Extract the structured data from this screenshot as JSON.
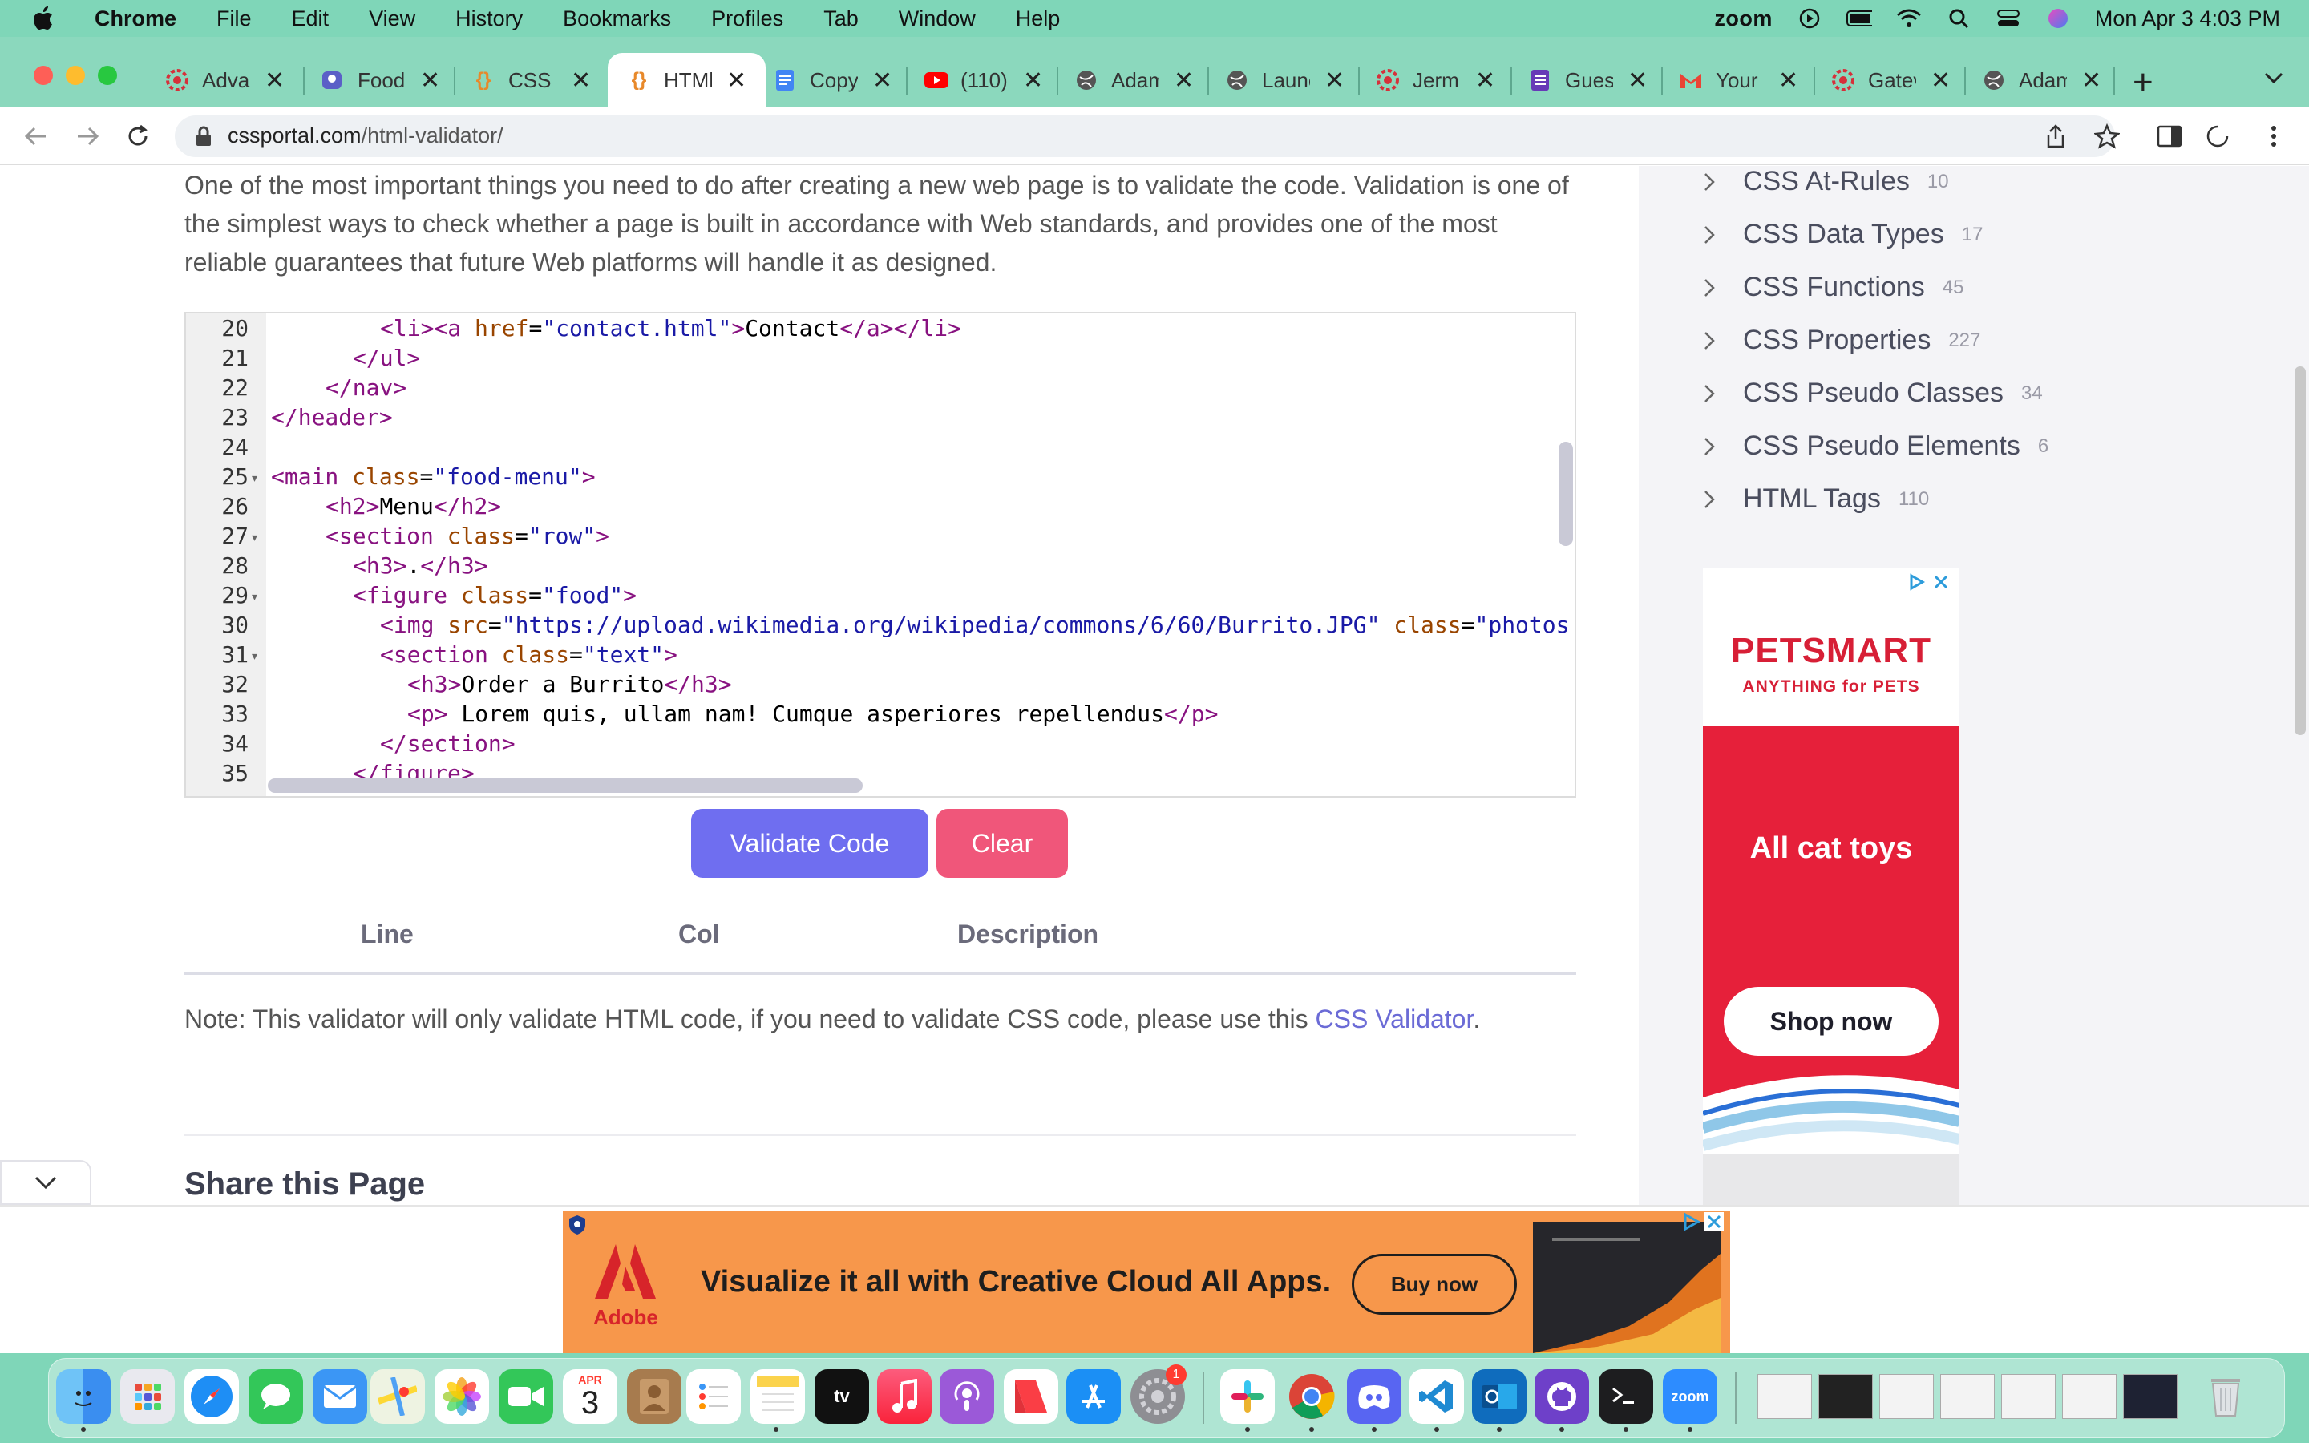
{
  "menubar": {
    "app_name": "Chrome",
    "menus": [
      "File",
      "Edit",
      "View",
      "History",
      "Bookmarks",
      "Profiles",
      "Tab",
      "Window",
      "Help"
    ],
    "zoom_label": "zoom",
    "datetime": "Mon Apr 3  4:03 PM"
  },
  "tabs": [
    {
      "title": "Advar",
      "icon": "gear-red-icon"
    },
    {
      "title": "Food",
      "icon": "teams-icon"
    },
    {
      "title": "CSS V",
      "icon": "braces-icon"
    },
    {
      "title": "HTMl",
      "icon": "braces-icon",
      "active": true
    },
    {
      "title": "Copy",
      "icon": "docs-icon"
    },
    {
      "title": "(110)",
      "icon": "youtube-icon"
    },
    {
      "title": "Adam",
      "icon": "globe-icon"
    },
    {
      "title": "Launc",
      "icon": "globe-icon"
    },
    {
      "title": "Jerm",
      "icon": "gear-red-icon"
    },
    {
      "title": "Gues",
      "icon": "forms-icon"
    },
    {
      "title": "Your",
      "icon": "gmail-icon"
    },
    {
      "title": "Gatev",
      "icon": "gear-red-icon"
    },
    {
      "title": "Adam",
      "icon": "globe-icon"
    }
  ],
  "address": {
    "domain": "cssportal.com",
    "path": "/html-validator/"
  },
  "page": {
    "intro": "One of the most important things you need to do after creating a new web page is to validate the code. Validation is one of the simplest ways to check whether a page is built in accordance with Web standards, and provides one of the most reliable guarantees that future Web platforms will handle it as designed.",
    "editor_lines": [
      {
        "n": "20",
        "fold": false
      },
      {
        "n": "21",
        "fold": false
      },
      {
        "n": "22",
        "fold": false
      },
      {
        "n": "23",
        "fold": false
      },
      {
        "n": "24",
        "fold": false
      },
      {
        "n": "25",
        "fold": true
      },
      {
        "n": "26",
        "fold": false
      },
      {
        "n": "27",
        "fold": true
      },
      {
        "n": "28",
        "fold": false
      },
      {
        "n": "29",
        "fold": true
      },
      {
        "n": "30",
        "fold": false
      },
      {
        "n": "31",
        "fold": true
      },
      {
        "n": "32",
        "fold": false
      },
      {
        "n": "33",
        "fold": false
      },
      {
        "n": "34",
        "fold": false
      },
      {
        "n": "35",
        "fold": false
      }
    ],
    "code": {
      "l20": {
        "t1": "<li><a ",
        "a1": "href",
        "eq": "=",
        "s1": "\"contact.html\"",
        "t2": ">",
        "txt": "Contact",
        "t3": "</a></li>"
      },
      "l21": "</ul>",
      "l22": "</nav>",
      "l23": "</header>",
      "l25": {
        "t1": "<main ",
        "a1": "class",
        "eq": "=",
        "s1": "\"food-menu\"",
        "t2": ">"
      },
      "l26": {
        "t1": "<h2>",
        "txt": "Menu",
        "t2": "</h2>"
      },
      "l27": {
        "t1": "<section ",
        "a1": "class",
        "eq": "=",
        "s1": "\"row\"",
        "t2": ">"
      },
      "l28": {
        "t1": "<h3>",
        "txt": ".",
        "t2": "</h3>"
      },
      "l29": {
        "t1": "<figure ",
        "a1": "class",
        "eq": "=",
        "s1": "\"food\"",
        "t2": ">"
      },
      "l30": {
        "t1": "<img ",
        "a1": "src",
        "eq": "=",
        "s1": "\"https://upload.wikimedia.org/wikipedia/commons/6/60/Burrito.JPG\"",
        "a2": "class",
        "eq2": "=",
        "s2": "\"photos"
      },
      "l31": {
        "t1": "<section ",
        "a1": "class",
        "eq": "=",
        "s1": "\"text\"",
        "t2": ">"
      },
      "l32": {
        "t1": "<h3>",
        "txt": "Order a Burrito",
        "t2": "</h3>"
      },
      "l33": {
        "t1": "<p>",
        "txt": " Lorem quis, ullam nam! Cumque asperiores repellendus",
        "t2": "</p>"
      },
      "l34": "</section>",
      "l35": "</figure>"
    },
    "validate_label": "Validate Code",
    "clear_label": "Clear",
    "columns": [
      "Line",
      "Col",
      "Description"
    ],
    "note_prefix": "Note: This validator will only validate HTML code, if you need to validate CSS code, please use this ",
    "note_link": "CSS Validator",
    "note_suffix": ".",
    "share_title": "Share this Page"
  },
  "sidebar": {
    "items": [
      {
        "label": "CSS At-Rules",
        "count": "10"
      },
      {
        "label": "CSS Data Types",
        "count": "17"
      },
      {
        "label": "CSS Functions",
        "count": "45"
      },
      {
        "label": "CSS Properties",
        "count": "227"
      },
      {
        "label": "CSS Pseudo Classes",
        "count": "34"
      },
      {
        "label": "CSS Pseudo Elements",
        "count": "6"
      },
      {
        "label": "HTML Tags",
        "count": "110"
      }
    ]
  },
  "ads": {
    "petsmart": {
      "logo": "PETSMART",
      "tagline": "ANYTHING for PETS",
      "headline": "All cat toys",
      "cta": "Shop now"
    },
    "adobe": {
      "brand": "Adobe",
      "headline": "Visualize it all with Creative Cloud All Apps.",
      "cta": "Buy now"
    }
  },
  "dock": {
    "calendar_month": "APR",
    "calendar_day": "3",
    "tv_label": "tv",
    "badge": "1",
    "zoom_label": "zoom"
  },
  "colors": {
    "desktop": "#7fd6b8",
    "validate_button": "#6f6ef0",
    "clear_button": "#f0567a",
    "link": "#6b6bd6",
    "petsmart_red": "#e6203a",
    "adobe_orange": "#f7974b"
  }
}
